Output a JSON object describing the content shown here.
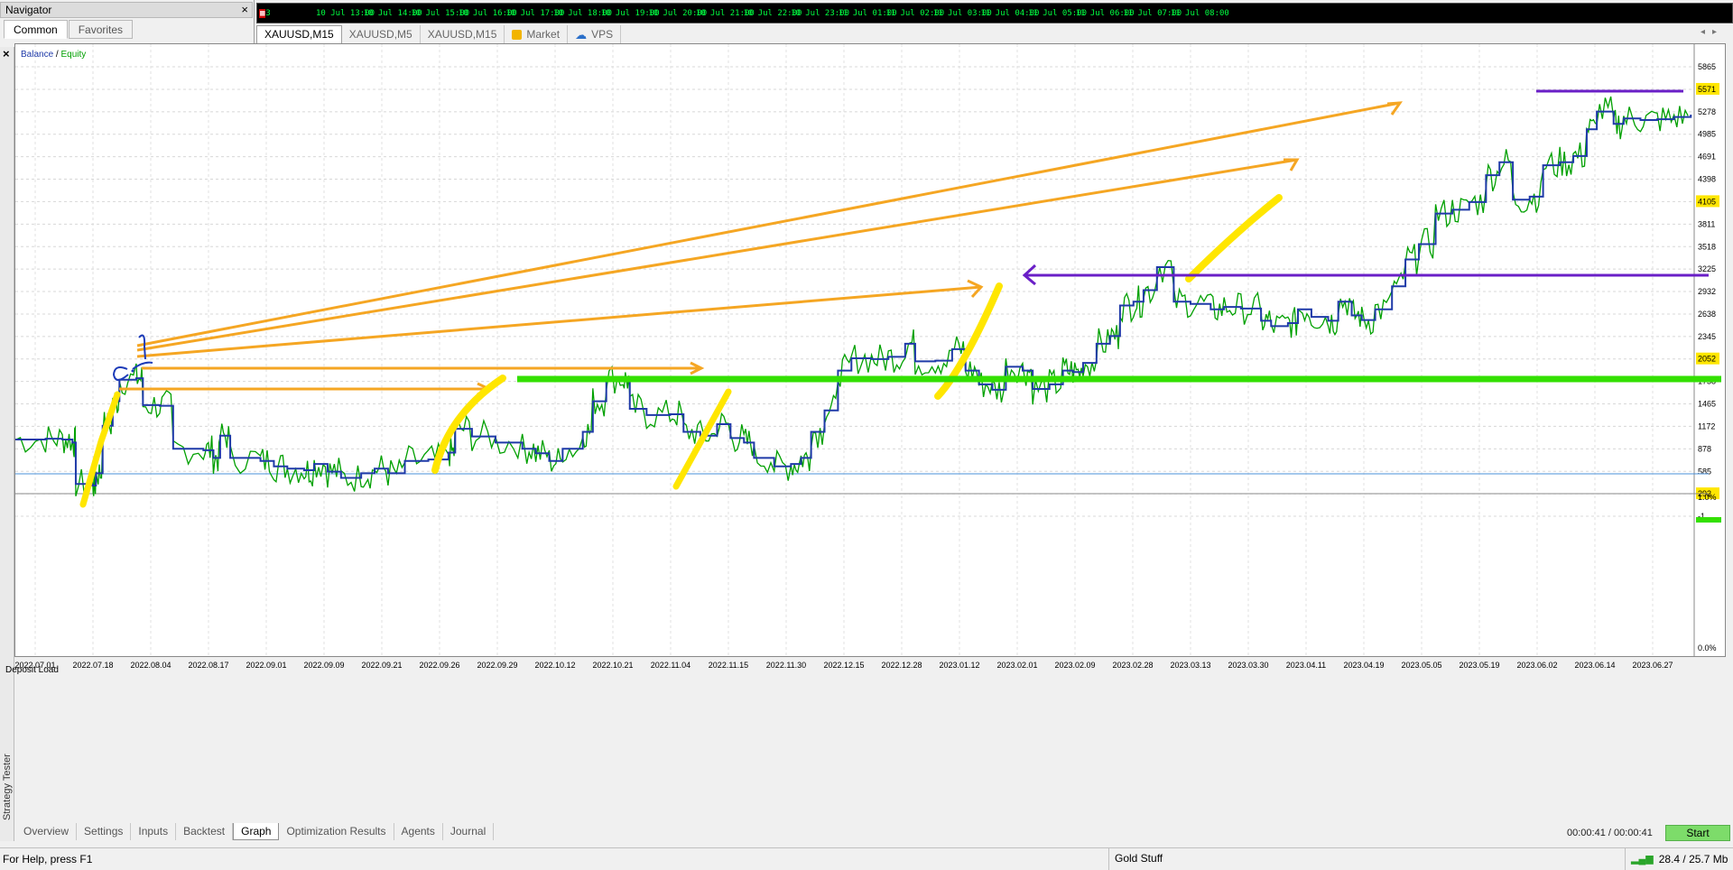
{
  "navigator": {
    "title": "Navigator",
    "tabs": [
      "Common",
      "Favorites"
    ],
    "active_tab": "Common",
    "close_glyph": "×"
  },
  "time_strip": {
    "first_partial": "3",
    "labels": [
      "10 Jul 13:00",
      "10 Jul 14:00",
      "10 Jul 15:00",
      "10 Jul 16:00",
      "10 Jul 17:00",
      "10 Jul 18:00",
      "10 Jul 19:00",
      "10 Jul 20:00",
      "10 Jul 21:00",
      "10 Jul 22:00",
      "10 Jul 23:00",
      "11 Jul 01:00",
      "11 Jul 02:00",
      "11 Jul 03:00",
      "11 Jul 04:00",
      "11 Jul 05:00",
      "11 Jul 06:00",
      "11 Jul 07:00",
      "11 Jul 08:00"
    ]
  },
  "chart_tabs": [
    {
      "label": "XAUUSD,M15",
      "active": true
    },
    {
      "label": "XAUUSD,M5",
      "active": false
    },
    {
      "label": "XAUUSD,M15",
      "active": false
    },
    {
      "label": "Market",
      "active": false,
      "icon": "bag-icon"
    },
    {
      "label": "VPS",
      "active": false,
      "icon": "cloud-icon"
    }
  ],
  "tester": {
    "side_label": "Strategy Tester",
    "legend_balance": "Balance",
    "legend_sep": " / ",
    "legend_equity": "Equity",
    "deposit_label": "Deposit Load",
    "bottom_tabs": [
      "Overview",
      "Settings",
      "Inputs",
      "Backtest",
      "Graph",
      "Optimization Results",
      "Agents",
      "Journal"
    ],
    "active_tab": "Graph",
    "elapsed": "00:00:41 / 00:00:41",
    "start_label": "Start"
  },
  "status": {
    "help": "For Help, press F1",
    "profile": "Gold Stuff",
    "traffic": "28.4 / 25.7 Mb"
  },
  "colors": {
    "balance": "#1f3aa8",
    "equity": "#00a000",
    "annot_orange": "#f5a623",
    "annot_yellow": "#ffe600",
    "annot_green": "#33e000",
    "annot_purple": "#6a1fc7",
    "annot_blue": "#1c3bb8",
    "start_btn": "#7ddc6a"
  },
  "chart_data": {
    "type": "line",
    "title": "",
    "series": [
      {
        "name": "Balance"
      },
      {
        "name": "Equity"
      }
    ],
    "x_tick_labels": [
      "2022.07.01",
      "2022.07.18",
      "2022.08.04",
      "2022.08.17",
      "2022.09.01",
      "2022.09.09",
      "2022.09.21",
      "2022.09.26",
      "2022.09.29",
      "2022.10.12",
      "2022.10.21",
      "2022.11.04",
      "2022.11.15",
      "2022.11.30",
      "2022.12.15",
      "2022.12.28",
      "2023.01.12",
      "2023.02.01",
      "2023.02.09",
      "2023.02.28",
      "2023.03.13",
      "2023.03.30",
      "2023.04.11",
      "2023.04.19",
      "2023.05.05",
      "2023.05.19",
      "2023.06.02",
      "2023.06.14",
      "2023.06.27"
    ],
    "y_tick_labels": [
      "5865",
      "5571",
      "5278",
      "4985",
      "4691",
      "4398",
      "4105",
      "3811",
      "3518",
      "3225",
      "2932",
      "2638",
      "2345",
      "2052",
      "1758",
      "1465",
      "1172",
      "878",
      "585",
      "292",
      "-1"
    ],
    "ylim": [
      -1,
      5865
    ],
    "highlighted_values": [
      "5571",
      "4105",
      "2052",
      "292"
    ],
    "balance_points": [
      [
        0,
        1000
      ],
      [
        0.018,
        1010
      ],
      [
        0.028,
        1000
      ],
      [
        0.034,
        960
      ],
      [
        0.036,
        420
      ],
      [
        0.046,
        400
      ],
      [
        0.048,
        560
      ],
      [
        0.052,
        1180
      ],
      [
        0.058,
        1500
      ],
      [
        0.062,
        1780
      ],
      [
        0.072,
        1800
      ],
      [
        0.076,
        1450
      ],
      [
        0.086,
        1440
      ],
      [
        0.094,
        880
      ],
      [
        0.112,
        860
      ],
      [
        0.118,
        760
      ],
      [
        0.122,
        1050
      ],
      [
        0.128,
        760
      ],
      [
        0.146,
        720
      ],
      [
        0.154,
        650
      ],
      [
        0.162,
        620
      ],
      [
        0.172,
        600
      ],
      [
        0.178,
        680
      ],
      [
        0.186,
        580
      ],
      [
        0.194,
        500
      ],
      [
        0.206,
        560
      ],
      [
        0.214,
        620
      ],
      [
        0.222,
        560
      ],
      [
        0.232,
        720
      ],
      [
        0.246,
        740
      ],
      [
        0.258,
        830
      ],
      [
        0.262,
        1140
      ],
      [
        0.272,
        1040
      ],
      [
        0.286,
        960
      ],
      [
        0.302,
        880
      ],
      [
        0.31,
        820
      ],
      [
        0.318,
        720
      ],
      [
        0.326,
        880
      ],
      [
        0.338,
        1100
      ],
      [
        0.344,
        1500
      ],
      [
        0.352,
        1800
      ],
      [
        0.362,
        1780
      ],
      [
        0.366,
        1400
      ],
      [
        0.376,
        1320
      ],
      [
        0.39,
        1330
      ],
      [
        0.398,
        1100
      ],
      [
        0.408,
        1050
      ],
      [
        0.418,
        1200
      ],
      [
        0.426,
        1020
      ],
      [
        0.434,
        960
      ],
      [
        0.44,
        760
      ],
      [
        0.452,
        650
      ],
      [
        0.462,
        680
      ],
      [
        0.468,
        760
      ],
      [
        0.474,
        1100
      ],
      [
        0.482,
        1380
      ],
      [
        0.49,
        1900
      ],
      [
        0.498,
        2060
      ],
      [
        0.51,
        2050
      ],
      [
        0.52,
        2080
      ],
      [
        0.53,
        2250
      ],
      [
        0.536,
        2020
      ],
      [
        0.548,
        2030
      ],
      [
        0.558,
        2180
      ],
      [
        0.566,
        1900
      ],
      [
        0.574,
        1720
      ],
      [
        0.582,
        1650
      ],
      [
        0.59,
        1950
      ],
      [
        0.6,
        1900
      ],
      [
        0.606,
        1660
      ],
      [
        0.616,
        1720
      ],
      [
        0.624,
        1900
      ],
      [
        0.63,
        1880
      ],
      [
        0.636,
        2000
      ],
      [
        0.644,
        2250
      ],
      [
        0.652,
        2350
      ],
      [
        0.658,
        2750
      ],
      [
        0.666,
        2800
      ],
      [
        0.672,
        2950
      ],
      [
        0.68,
        3250
      ],
      [
        0.69,
        2800
      ],
      [
        0.7,
        2770
      ],
      [
        0.712,
        2700
      ],
      [
        0.72,
        2730
      ],
      [
        0.73,
        2710
      ],
      [
        0.742,
        2550
      ],
      [
        0.748,
        2480
      ],
      [
        0.758,
        2520
      ],
      [
        0.764,
        2700
      ],
      [
        0.772,
        2600
      ],
      [
        0.782,
        2550
      ],
      [
        0.788,
        2800
      ],
      [
        0.796,
        2620
      ],
      [
        0.802,
        2560
      ],
      [
        0.81,
        2700
      ],
      [
        0.82,
        3000
      ],
      [
        0.828,
        3350
      ],
      [
        0.836,
        3550
      ],
      [
        0.846,
        3950
      ],
      [
        0.856,
        4000
      ],
      [
        0.866,
        4100
      ],
      [
        0.876,
        4450
      ],
      [
        0.884,
        4620
      ],
      [
        0.892,
        4130
      ],
      [
        0.902,
        4170
      ],
      [
        0.91,
        4580
      ],
      [
        0.92,
        4620
      ],
      [
        0.928,
        4700
      ],
      [
        0.936,
        5050
      ],
      [
        0.942,
        5280
      ],
      [
        0.952,
        5120
      ],
      [
        0.958,
        5190
      ],
      [
        0.968,
        5170
      ],
      [
        0.978,
        5180
      ],
      [
        0.988,
        5210
      ],
      [
        0.998,
        5240
      ]
    ]
  }
}
